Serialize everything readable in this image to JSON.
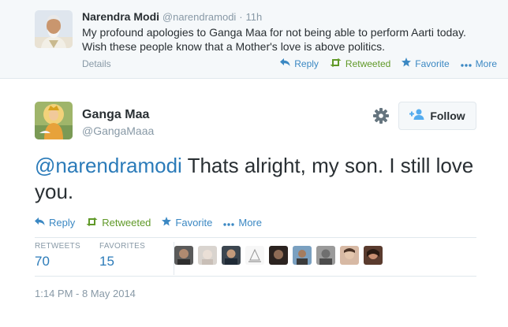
{
  "reply_tweet": {
    "name": "Narendra Modi",
    "handle": "@narendramodi",
    "dot": "·",
    "time": "11h",
    "text": "My profound apologies to Ganga Maa for not being able to perform Aarti today. Wish these people know that a Mother's love is above politics.",
    "details_label": "Details",
    "actions": {
      "reply": "Reply",
      "retweeted": "Retweeted",
      "favorite": "Favorite",
      "more": "More"
    }
  },
  "main_tweet": {
    "name": "Ganga Maa",
    "handle": "@GangaMaaa",
    "follow_label": "Follow",
    "mention": "@narendramodi",
    "text": " Thats alright, my son. I still love you.",
    "actions": {
      "reply": "Reply",
      "retweeted": "Retweeted",
      "favorite": "Favorite",
      "more": "More"
    },
    "stats": {
      "retweets_label": "RETWEETS",
      "retweets_value": "70",
      "favorites_label": "FAVORITES",
      "favorites_value": "15"
    },
    "timestamp": "1:14 PM - 8 May 2014"
  },
  "colors": {
    "link": "#2b7bb9",
    "retweet_green": "#609928",
    "muted": "#8899a6",
    "text": "#292f33"
  },
  "icons": {
    "reply": "reply-arrow-icon",
    "retweet": "retweet-icon",
    "favorite": "star-icon",
    "more": "ellipsis-icon",
    "settings": "gear-icon",
    "follow": "add-user-icon"
  }
}
